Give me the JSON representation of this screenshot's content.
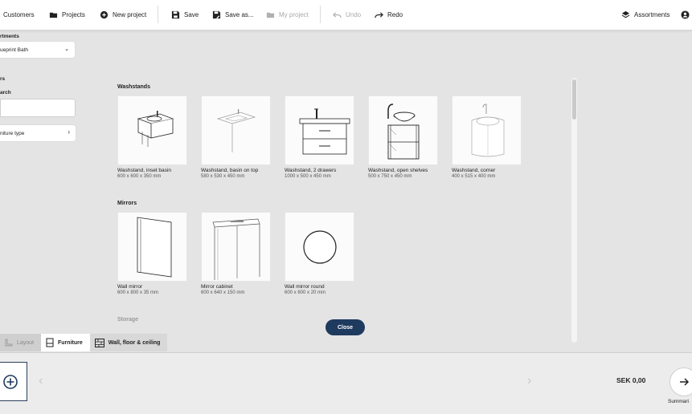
{
  "toolbar": {
    "customers": "Customers",
    "projects": "Projects",
    "new_project": "New project",
    "save": "Save",
    "save_as": "Save as...",
    "my_project": "My project",
    "undo": "Undo",
    "redo": "Redo",
    "assortments": "Assortments"
  },
  "left_panel": {
    "departments_label": "rtments",
    "departments_value": "ueprint Bath",
    "filters_label": "rs",
    "search_label": "arch",
    "search_value": "",
    "furniture_type": "niture type"
  },
  "catalog": {
    "washstands_title": "Washstands",
    "washstands": [
      {
        "name": "Washstand, inset basin",
        "dims": "600 x 600 x 350 mm"
      },
      {
        "name": "Washstand, basin on top",
        "dims": "580 x 530 x 450 mm"
      },
      {
        "name": "Washstand, 2 drawers",
        "dims": "1000 x 500 x 450 mm"
      },
      {
        "name": "Washstand, open shelves",
        "dims": "500 x 750 x 450 mm"
      },
      {
        "name": "Washstand, corner",
        "dims": "400 x 515 x 400 mm"
      }
    ],
    "mirrors_title": "Mirrors",
    "mirrors": [
      {
        "name": "Wall mirror",
        "dims": "600 x 800 x 35 mm"
      },
      {
        "name": "Mirror cabinet",
        "dims": "600 x 640 x 150 mm"
      },
      {
        "name": "Wall mirror round",
        "dims": "600 x 600 x 20 mm"
      }
    ],
    "storage_title": "Storage"
  },
  "close_label": "Close",
  "tabs": {
    "layout": "Layout",
    "furniture": "Furniture",
    "wall_floor": "Wall, floor & ceiling"
  },
  "bottom": {
    "price": "SEK  0,00",
    "summary": "Summari"
  },
  "colors": {
    "accent": "#1f3a5f",
    "background": "#e4e4e4"
  }
}
